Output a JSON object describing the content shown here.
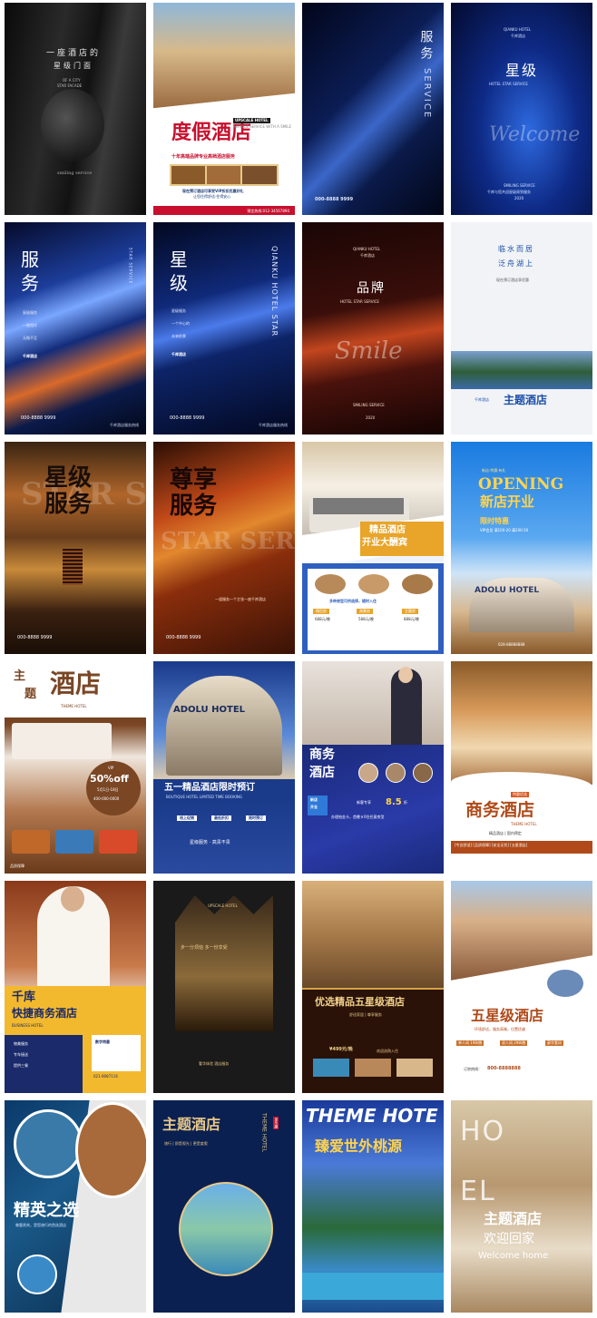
{
  "posters": {
    "p1": {
      "cn_title": "一座酒店的",
      "cn_title2": "星级门面",
      "en_sub": "OF A CITY",
      "en_sub2": "STAR FACADE",
      "footer": "smiling service"
    },
    "p2": {
      "title": "度假酒店",
      "badge": "UPSCALE HOTEL",
      "en_tagline": "SERVICE SERVICE WITH A SMILE",
      "slogan": "十年高端品牌专业高档酒店服务",
      "promo": "现在预订酒店可享受VIP折扣优惠好礼",
      "promo2": "让您住得舒适·住得安心",
      "phone": "预定热线:012-34567890"
    },
    "p3": {
      "vertical_cn": "服务",
      "vertical_en": "SERVICE",
      "phone": "000-8888 9999"
    },
    "p4": {
      "en_brand": "QIANKU HOTEL",
      "brand_cn": "千库酒店",
      "title": "星级",
      "en_sub": "HOTEL STAR SERVICE",
      "script": "Welcome",
      "footer_en": "SMILING SERVICE",
      "footer_cn": "千库与您共迎星级周到服务",
      "year": "2020"
    },
    "p5": {
      "title": "服务",
      "vertical_en": "STAR SERVICE",
      "sub1": "星级服务",
      "sub2": "一路相伴",
      "sub3": "无微不至",
      "brand": "千库酒店",
      "phone": "000-8888 9999",
      "footer": "千库酒店服务热线"
    },
    "p6": {
      "title": "星级",
      "vertical_en": "QIANKU HOTEL STAR",
      "sub1": "星级服务",
      "sub2": "一个中心的",
      "sub3": "未来前景",
      "brand": "千库酒店",
      "phone": "000-8888 9999",
      "footer": "千库酒店服务热线"
    },
    "p7": {
      "en_brand": "QIANKU HOTEL",
      "brand_cn": "千库酒店",
      "title": "品牌",
      "en_sub": "HOTEL STAR SERVICE",
      "script": "Smile",
      "footer_en": "SMILING SERVICE",
      "year": "2020"
    },
    "p8": {
      "title1": "临水而居",
      "title2": "泛舟湖上",
      "note": "现在预订酒店享优惠",
      "brand": "主题酒店",
      "brand_sub": "千库酒店"
    },
    "p9": {
      "title": "星级服务",
      "en_overlay": "STAR SERVICE",
      "phone": "000-8888 9999"
    },
    "p10": {
      "title": "尊享服务",
      "en_overlay": "STAR SERVICE",
      "line": "一道服务一个主张一座千库酒店",
      "phone": "000-8888 9999"
    },
    "p11": {
      "title1": "精品酒店",
      "title2": "开业大酬宾",
      "rooms_title": "多种房型可供选择，随时入住",
      "room1": "情侣房",
      "room2": "海景房",
      "room3": "主题房",
      "price1": "688元/晚",
      "price2": "588元/晚",
      "price3": "888元/晚"
    },
    "p12": {
      "title_en": "OPENING",
      "title_cn": "新店开业",
      "tag": "新店·特惠·有礼",
      "sub": "限时特惠",
      "vip": "VIP会员 满100-20 满200-50",
      "sign": "ADOLU HOTEL",
      "phone": "028-88888888"
    },
    "p13": {
      "title1": "主",
      "title2": "题",
      "title3": "酒店",
      "en": "THEME HOTEL",
      "vip": "VIP",
      "discount": "50%off",
      "date": "5月1日-18日",
      "phone": "400-000-0000",
      "footer": "品质保障"
    },
    "p14": {
      "sign": "ADOLU HOTEL",
      "title": "五一精品酒店限时预订",
      "en": "BOUTIQUE HOTEL LIMITED TIME BOOKING",
      "btn1": "线上促销",
      "btn2": "最低折扣",
      "btn3": "限时预订",
      "line": "星级服务 · 高贵不贵"
    },
    "p15": {
      "title1": "商务",
      "title2": "酒店",
      "badge1": "新店",
      "badge2": "开业",
      "offer": "新客专享",
      "offer_num": "8.5",
      "offer_unit": "折",
      "offer2": "办理铂金卡，首晚￥0住任意房型"
    },
    "p16": {
      "title": "商务酒店",
      "en": "THEME HOTEL",
      "badge": "特惠优选",
      "sub": "精品酒店 | 国内预定",
      "footer": "[专业舒适] [品质保障] [安全无忧] [五星酒店]"
    },
    "p17": {
      "brand": "千库",
      "title": "快捷商务酒店",
      "en": "BUSINESS HOTEL",
      "item1": "物美服务",
      "item2": "专车接送",
      "item3": "提供三餐",
      "box": "数字特惠",
      "phone": "021-8087116"
    },
    "p18": {
      "badge": "UPSCALE HOTEL",
      "title": "步一分烦恼 多一份享受",
      "footer": "奢华体验 酒店服务"
    },
    "p19": {
      "title": "优选精品五星级酒店",
      "sub": "舒适家居 | 尊享服务",
      "price": "¥499元/晚",
      "price_note": "欢迎选购入住"
    },
    "p20": {
      "title": "五星级酒店",
      "sub": "环境舒适，服务高端，位置优越",
      "chip1": "单人间 198/晚",
      "chip2": "双人间 298/晚",
      "chip3": "豪华套间",
      "phone_label": "订房热线：",
      "phone": "800-8888888"
    },
    "p21": {
      "title": "精英之选",
      "sub": "尊重贵宾，是您旅行的首选酒店"
    },
    "p22": {
      "title": "主题酒店",
      "en": "THEME HOTEL",
      "tag": "享乐趣",
      "sub": "旅行 | 即是观光 | 更是度假"
    },
    "p23": {
      "title_en": "THEME HOTE",
      "title_cn": "臻爱世外桃源"
    },
    "p24": {
      "big_en1": "HO",
      "big_en2": "EL",
      "title": "主题酒店",
      "sub": "欢迎回家",
      "welcome": "Welcome home"
    }
  },
  "colors": {
    "red": "#c8102e",
    "navy": "#0a2a6e",
    "gold": "#d9a441",
    "orange": "#e87d1e",
    "blue": "#1b4fa8"
  }
}
